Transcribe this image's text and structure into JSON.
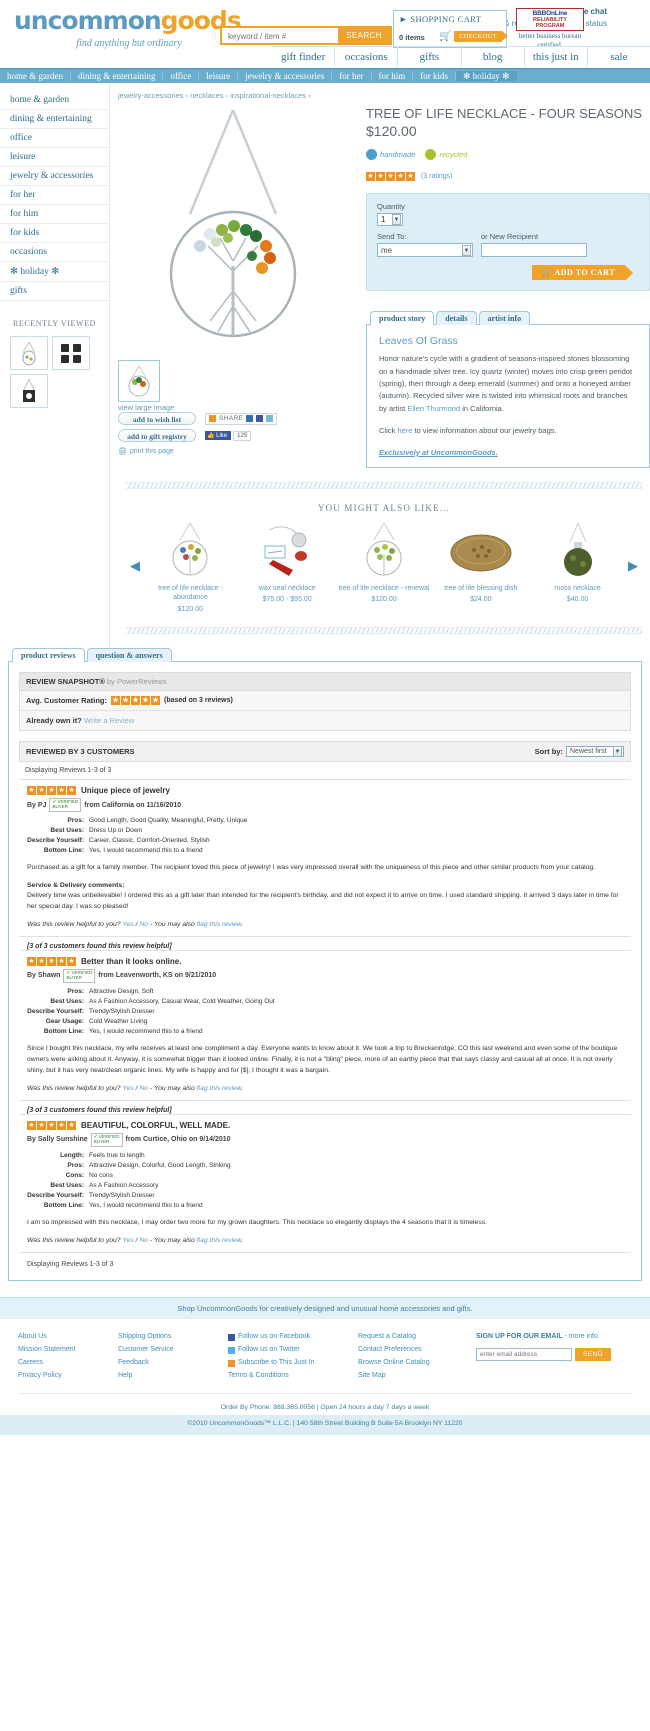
{
  "header": {
    "logo_un": "uncommon",
    "logo_goods": "goods",
    "tagline": "find anything but ordinary",
    "phone": "888.365.0056 . live chat",
    "phone_sub": "wish list & registry. check order status",
    "search_placeholder": "keyword / item #",
    "search_button": "SEARCH",
    "cart_title": "SHOPPING CART",
    "cart_items": "0 items",
    "checkout": "CHECKOUT",
    "bbb_line1": "BBBOnLine",
    "bbb_line2": "RELIABILITY",
    "bbb_line3": "PROGRAM",
    "bbb_caption": "better business bureau certified.",
    "topnav": [
      "gift finder",
      "occasions",
      "gifts",
      "blog",
      "this just in",
      "sale"
    ],
    "mainnav": [
      "home & garden",
      "dining & entertaining",
      "office",
      "leisure",
      "jewelry & accessories",
      "for her",
      "for him",
      "for kids",
      "✻  holiday  ✻"
    ]
  },
  "sidebar": {
    "categories": [
      "home & garden",
      "dining & entertaining",
      "office",
      "leisure",
      "jewelry & accessories",
      "for her",
      "for him",
      "for kids",
      "occasions",
      "✻  holiday  ✻",
      "gifts"
    ],
    "recently_viewed_title": "RECENTLY VIEWED"
  },
  "breadcrumb": [
    "jewelry-accessories",
    "necklaces",
    "inspirational-necklaces"
  ],
  "product": {
    "title": "TREE OF LIFE NECKLACE - FOUR SEASONS",
    "price": "$120.00",
    "badges": [
      {
        "label": "handmade",
        "color": "#4a9fc9"
      },
      {
        "label": "recycled",
        "color": "#a8c22e"
      }
    ],
    "rating_stars": 5,
    "ratings_label": "(3 ratings)",
    "view_large": "view large image",
    "wishlist_button": "add to wish list",
    "registry_button": "add to gift registry",
    "share_label": "SHARE",
    "like_label": "Like",
    "like_count": "125",
    "print_label": "print this page"
  },
  "buybox": {
    "quantity_label": "Quantity",
    "quantity_value": "1",
    "sendto_label": "Send To:",
    "sendto_value": "me",
    "recipient_label": "or New Recipient",
    "recipient_value": "",
    "add_to_cart": "ADD TO CART"
  },
  "tabs": {
    "items": [
      "product story",
      "details",
      "artist info"
    ],
    "active": "product story",
    "story_heading": "Leaves Of Grass",
    "story_body_1": "Honor nature's cycle with a gradient of seasons-inspired stones blossoming on a handmade silver tree. Icy quartz (winter) moves into crisp green peridot (spring), then through a deep emerald (summer) and onto a honeyed amber (autumn). Recycled silver wire is twisted into whimsical roots and branches by artist ",
    "story_artist_link": "Ellen Thurmond",
    "story_body_2": " in California.",
    "bags_pre": "Click ",
    "bags_link": "here",
    "bags_post": " to view information about our jewelry bags.",
    "exclusive": "Exclusively at UncommonGoods."
  },
  "carousel": {
    "heading": "YOU MIGHT ALSO LIKE...",
    "prev": "◀",
    "next": "▶",
    "items": [
      {
        "name": "tree of life necklace - abundance",
        "price": "$120.00"
      },
      {
        "name": "wax seal necklace",
        "price": "$75.00 - $95.00"
      },
      {
        "name": "tree of life necklace - renewal",
        "price": "$120.00"
      },
      {
        "name": "tree of life blessing dish",
        "price": "$24.00"
      },
      {
        "name": "moss necklace",
        "price": "$40.00"
      }
    ]
  },
  "reviews": {
    "tabs": [
      "product reviews",
      "question & answers"
    ],
    "active_tab": "product reviews",
    "snapshot_title": "REVIEW SNAPSHOT®",
    "snapshot_by": "by PowerReviews",
    "avg_label": "Avg. Customer Rating:",
    "avg_stars": 5,
    "avg_note": "(based on 3 reviews)",
    "own_it": "Already own it?",
    "write_review": "Write a Review",
    "reviewed_by": "REVIEWED BY 3 CUSTOMERS",
    "sort_label": "Sort by:",
    "sort_value": "Newest first",
    "displaying": "Displaying Reviews 1-3 of 3",
    "displaying_bottom": "Displaying Reviews 1-3 of 3",
    "verified_badge_1": "VERIFIED",
    "verified_badge_2": "BUYER",
    "helpful_prefix": "Was this review helpful to you?",
    "helpful_yes": "Yes",
    "helpful_no": "No",
    "helpful_mid": " - You may also ",
    "helpful_flag": "flag this review",
    "list": [
      {
        "stars": 5,
        "title": "Unique piece of jewelry",
        "by": "By PJ",
        "from": "from California on 11/16/2010",
        "attrs": [
          {
            "k": "Pros:",
            "v": "Good Length, Good Quality, Meaningful, Pretty, Unique"
          },
          {
            "k": "Best Uses:",
            "v": "Dress Up or Down"
          },
          {
            "k": "Describe Yourself:",
            "v": "Career, Classic, Comfort-Oriented, Stylish"
          },
          {
            "k": "Bottom Line:",
            "v": "Yes, I would recommend this to a friend"
          }
        ],
        "body": "Purchased as a gift for a family member. The recipient loved this piece of jewelry! I was very impressed overall with the uniqueness of this piece and other similar products from your catalog.",
        "service_heading": "Service & Delivery comments:",
        "service_body": "Delivery time was unbelievable! I ordered this as a gift later than intended for the recipient's birthday, and did not expect it to arrive on time. I used standard shipping. It arrived 3 days later in time for her special day. I was so pleased!",
        "helpful_count": "[3 of 3 customers found this review helpful]"
      },
      {
        "stars": 5,
        "title": "Better than it looks online.",
        "by": "By Shawn",
        "from": "from Leavenworth, KS on 9/21/2010",
        "attrs": [
          {
            "k": "Pros:",
            "v": "Attractive Design, Soft"
          },
          {
            "k": "Best Uses:",
            "v": "As A Fashion Accessory, Casual Wear, Cold Weather, Going Out"
          },
          {
            "k": "Describe Yourself:",
            "v": "Trendy/Stylish Dresser"
          },
          {
            "k": "Gear Usage:",
            "v": "Cold Weather Living"
          },
          {
            "k": "Bottom Line:",
            "v": "Yes, I would recommend this to a friend"
          }
        ],
        "body": "Since I bought this necklace, my wife receives at least one compliment a day. Everyone wants to know about it. We took a trip to Breckenridge, CO this last weekend and even some of the boutique owners were asking about it. Anyway, it is somewhat bigger than it looked online. Finally, it is not a \"bling\" piece, more of an earthy piece that that says classy and casual all at once. It is not overly shiny, but it has very neat/clean organic lines. My wife is happy and for [$], I thought it was a bargain.",
        "helpful_count": "[3 of 3 customers found this review helpful]"
      },
      {
        "stars": 5,
        "title": "BEAUTIFUL, COLORFUL, WELL MADE.",
        "by": "By Sally Sunshine",
        "from": "from Curtice, Ohio on 9/14/2010",
        "attrs": [
          {
            "k": "Length:",
            "v": "Feels true to length"
          },
          {
            "k": "Pros:",
            "v": "Attractive Design, Colorful, Good Length, Striking"
          },
          {
            "k": "Cons:",
            "v": "No cons"
          },
          {
            "k": "Best Uses:",
            "v": "As A Fashion Accessory"
          },
          {
            "k": "Describe Yourself:",
            "v": "Trendy/Stylish Dresser"
          },
          {
            "k": "Bottom Line:",
            "v": "Yes, I would recommend this to a friend"
          }
        ],
        "body": "I am so impressed with this necklace, I may order two more for my grown daughters. This necklace so elegantly displays the 4 seasons that it is timeless.",
        "helpful_count": ""
      }
    ]
  },
  "footer": {
    "shop_line": "Shop UncommonGoods for creatively designed and unusual home accessories and gifts.",
    "col1": [
      "About Us",
      "Mission Statement",
      "Careers",
      "Privacy Policy"
    ],
    "col2": [
      "Shipping Options",
      "Customer Service",
      "Feedback",
      "Help"
    ],
    "col3": [
      "Follow us on Facebook",
      "Follow us on Twitter",
      "Subscribe to This Just In",
      "Terms & Conditions"
    ],
    "col4": [
      "Request a Catalog",
      "Contact Preferences",
      "Browse Online Catalog",
      "Site Map"
    ],
    "signup_title": "SIGN UP FOR OUR EMAIL",
    "signup_more": "- more info",
    "signup_placeholder": "enter email address",
    "signup_button": "SEND",
    "order_line": "Order By Phone: 888.365.0056 | Open 24 hours a day 7 days a week",
    "copyright": "©2010 UncommonGoods™ L.L.C. | 140 58th Street Building B Suite 5A Brooklyn NY 11220"
  }
}
